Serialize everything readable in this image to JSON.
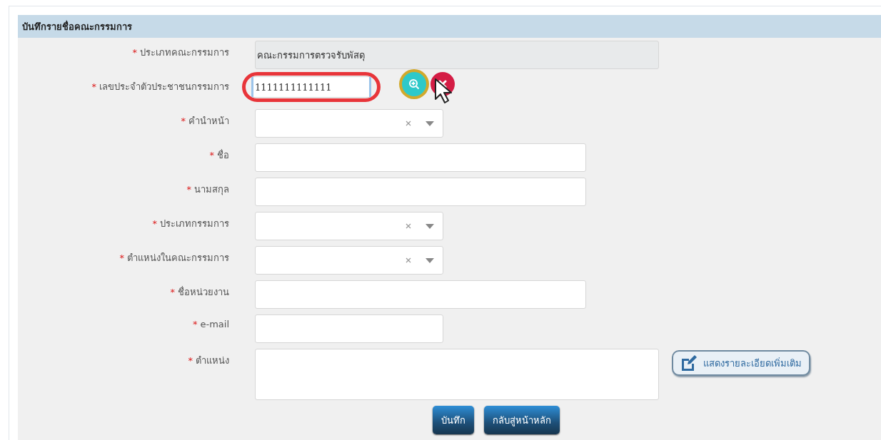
{
  "panel": {
    "title": "บันทึกรายชื่อคณะกรรมการ"
  },
  "fields": [
    {
      "label": "ประเภทคณะกรรมการ",
      "mark": "*",
      "kind": "readonly",
      "value": "คณะกรรมการตรวจรับพัสดุ"
    },
    {
      "label": "เลขประจำตัวประชาชนกรรมการ",
      "mark": "*",
      "kind": "id",
      "value": "1111111111111",
      "highlighted": true
    },
    {
      "label": "คำนำหน้า",
      "mark": "*",
      "kind": "select"
    },
    {
      "label": "ชื่อ",
      "mark": "*",
      "kind": "text"
    },
    {
      "label": "นามสกุล",
      "mark": "*",
      "kind": "text"
    },
    {
      "label": "ประเภทกรรมการ",
      "mark": "*",
      "kind": "select"
    },
    {
      "label": "ตำแหน่งในคณะกรรมการ",
      "mark": "*",
      "kind": "select"
    },
    {
      "label": "ชื่อหน่วยงาน",
      "mark": "*",
      "kind": "text"
    },
    {
      "label": "e-mail",
      "mark": "*",
      "kind": "short"
    },
    {
      "label": "ตำแหน่ง",
      "mark": "*",
      "kind": "textarea",
      "extra_button": "แสดงรายละเอียดเพิ่มเติม"
    }
  ],
  "buttons": [
    "บันทึก",
    "กลับสู่หน้าหลัก"
  ]
}
